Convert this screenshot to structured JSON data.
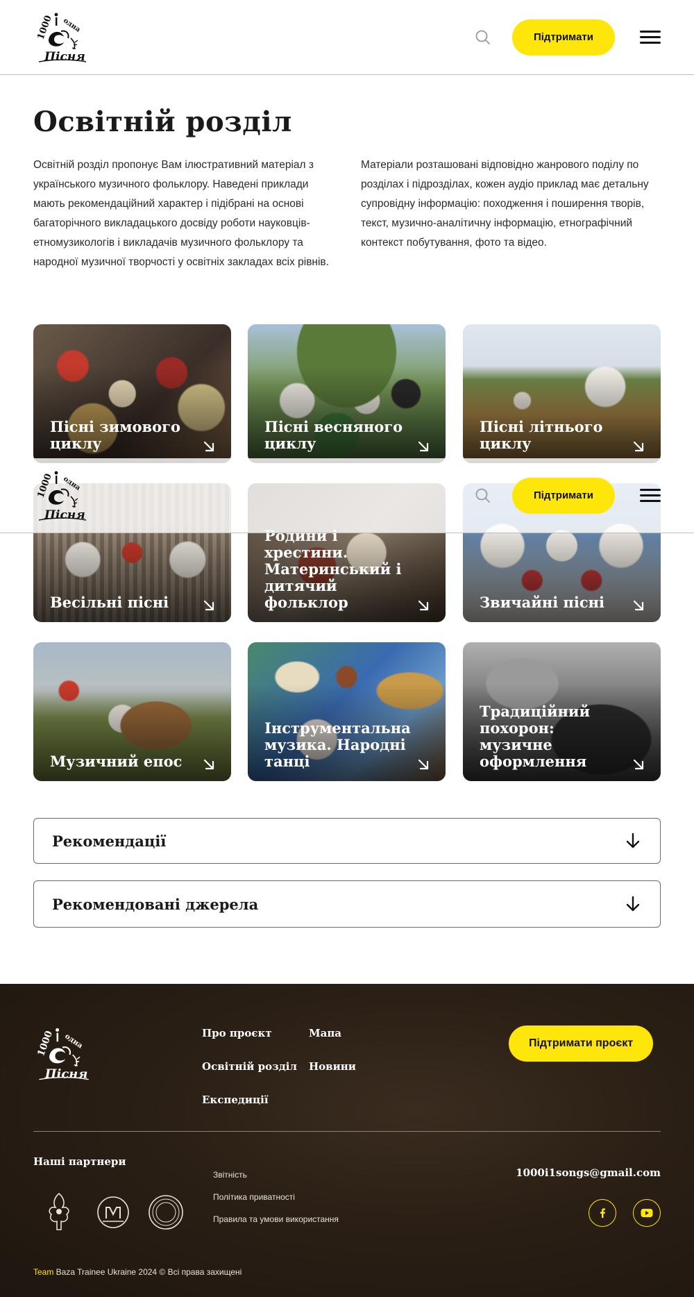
{
  "header": {
    "logo_text": "1000 одна пісня",
    "search_icon": "search-icon",
    "support_label": "Підтримати",
    "menu_icon": "hamburger-menu-icon"
  },
  "page": {
    "title": "Освітній розділ",
    "intro_left": "Освітній розділ пропонує Вам ілюстративний матеріал з українського музичного фольклору. Наведені приклади мають рекомендаційний характер і підібрані на основі багаторічного викладацького досвіду роботи науковців-етномузикологів і викладачів музичного фольклору та народної музичної творчості у освітніх закладах всіх рівнів.",
    "intro_right": "Матеріали розташовані відповідно жанрового поділу по розділах і підрозділах, кожен аудіо приклад має детальну супровідну інформацію: походження і поширення творів, текст, музично-аналітичну інформацію, етнографічний контекст побутування, фото та відео."
  },
  "cards": [
    {
      "title": "Пісні зимового циклу"
    },
    {
      "title": "Пісні весняного циклу"
    },
    {
      "title": "Пісні літнього циклу"
    },
    {
      "title": "Весільні пісні"
    },
    {
      "title": "Родини і хрестини. Материнський і дитячий фольклор"
    },
    {
      "title": "Звичайні пісні"
    },
    {
      "title": "Музичний епос"
    },
    {
      "title": "Інструментальна музика. Народні танці"
    },
    {
      "title": "Традиційний похорон: музичне оформлення"
    }
  ],
  "accordions": [
    {
      "title": "Рекомендації"
    },
    {
      "title": "Рекомендовані джерела"
    }
  ],
  "footer": {
    "nav": [
      "Про проєкт",
      "Мапа",
      "Освітній розділ",
      "Новини",
      "Експедиції"
    ],
    "support_label": "Підтримати проєкт",
    "partners_title": "Наші партнери",
    "links": [
      "Звітність",
      "Політика приватності",
      "Правила та умови використання"
    ],
    "email": "1000i1songs@gmail.com",
    "social": [
      "facebook-icon",
      "youtube-icon"
    ],
    "copyright_team": "Team",
    "copyright_rest": " Baza Trainee Ukraine 2024 © Всі права захищені"
  },
  "colors": {
    "accent": "#ffe60a",
    "footer_bg": "#2a1f15"
  }
}
